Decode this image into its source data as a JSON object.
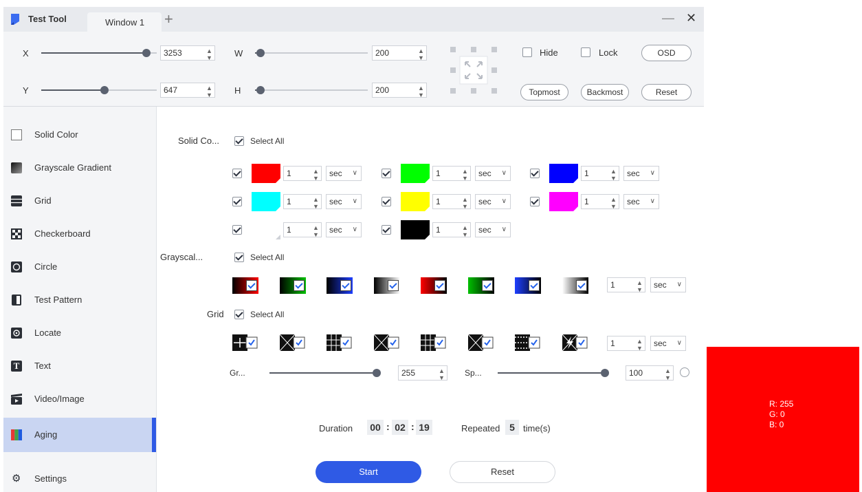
{
  "app": {
    "title": "Test Tool",
    "tab": "Window 1"
  },
  "position": {
    "x_label": "X",
    "x_value": "3253",
    "x_level": 0.91,
    "y_label": "Y",
    "y_value": "647",
    "y_level": 0.55,
    "w_label": "W",
    "w_value": "200",
    "w_level": 0.05,
    "h_label": "H",
    "h_value": "200",
    "h_level": 0.05
  },
  "options": {
    "hide": "Hide",
    "lock": "Lock",
    "osd": "OSD",
    "topmost": "Topmost",
    "backmost": "Backmost",
    "reset": "Reset"
  },
  "sidebar": {
    "items": [
      {
        "label": "Solid Color",
        "icon": "square-outline-icon"
      },
      {
        "label": "Grayscale Gradient",
        "icon": "gradient-icon"
      },
      {
        "label": "Grid",
        "icon": "grid-icon"
      },
      {
        "label": "Checkerboard",
        "icon": "checkerboard-icon"
      },
      {
        "label": "Circle",
        "icon": "circle-icon"
      },
      {
        "label": "Test Pattern",
        "icon": "test-pattern-icon"
      },
      {
        "label": "Locate",
        "icon": "locate-icon"
      },
      {
        "label": "Text",
        "icon": "text-icon"
      },
      {
        "label": "Video/Image",
        "icon": "video-icon"
      },
      {
        "label": "Aging",
        "icon": "aging-icon"
      }
    ],
    "settings": "Settings",
    "active_color": "#c9d5f2"
  },
  "solid": {
    "section_label": "Solid Co...",
    "select_all": "Select All",
    "unit": "sec",
    "duration": "1",
    "colors": [
      "#ff0000",
      "#00ff00",
      "#0000ff",
      "#00ffff",
      "#ffff00",
      "#ff00ff",
      "#ffffff",
      "#000000"
    ]
  },
  "grayscale": {
    "section_label": "Grayscal...",
    "select_all": "Select All",
    "duration": "1",
    "unit": "sec"
  },
  "grid": {
    "section_label": "Grid",
    "select_all": "Select All",
    "duration": "1",
    "unit": "sec"
  },
  "levels": {
    "gray_label": "Gr...",
    "gray_value": "255",
    "gray_level": 1.0,
    "speed_label": "Sp...",
    "speed_value": "100",
    "speed_level": 1.0
  },
  "aging": {
    "duration_label": "Duration",
    "hours": "00",
    "minutes": "02",
    "seconds": "19",
    "sep": ":",
    "repeated_label": "Repeated",
    "repeated_value": "5",
    "times_label": "time(s)",
    "start": "Start",
    "reset": "Reset",
    "accent": "#2f5ae5"
  },
  "preview": {
    "color": "#ff0000",
    "r": "R: 255",
    "g": "G: 0",
    "b": "B: 0"
  }
}
